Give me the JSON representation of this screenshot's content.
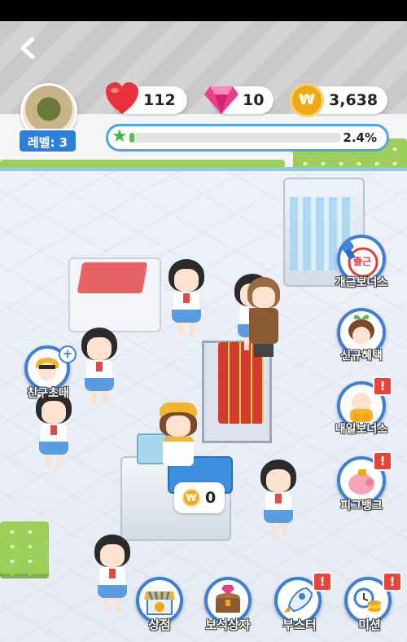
{
  "hud": {
    "back_icon": "chevron-left-icon",
    "level_label": "레벨: 3",
    "hearts": "112",
    "gems": "10",
    "coins": "3,638",
    "xp_percent_text": "2.4%",
    "xp_fraction": 0.024
  },
  "side_buttons": [
    {
      "label": "개근보너스",
      "icon": "stamp-icon"
    },
    {
      "label": "신규혜택",
      "icon": "new-benefit-icon"
    },
    {
      "label": "내일보너스",
      "icon": "tomorrow-bonus-icon"
    },
    {
      "label": "피그뱅크",
      "icon": "piggy-bank-icon"
    }
  ],
  "invite": {
    "label": "친구초대",
    "icon": "invite-friend-icon"
  },
  "stamp_text": "출근",
  "register_cash": "0",
  "bottom_nav": [
    {
      "label": "상점",
      "icon": "shop-icon",
      "alert": ""
    },
    {
      "label": "보석상자",
      "icon": "treasure-chest-icon",
      "alert": ""
    },
    {
      "label": "부스터",
      "icon": "rocket-icon",
      "alert": "!"
    },
    {
      "label": "미션",
      "icon": "mission-icon",
      "alert": "!"
    }
  ],
  "alerts": {
    "piggy": "!",
    "tomorrow": "!"
  },
  "colors": {
    "accent": "#3b7fd8",
    "heart": "#e8313b",
    "gem": "#ea3d8c",
    "coin": "#f1a817",
    "xp": "#5bc04a"
  }
}
